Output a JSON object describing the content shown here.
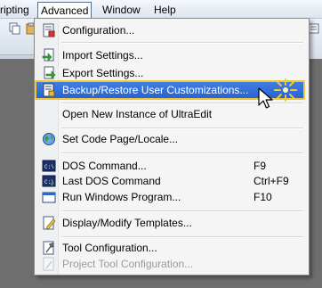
{
  "menubar": {
    "items": [
      {
        "label": "ripting"
      },
      {
        "label": "Advanced"
      },
      {
        "label": "Window"
      },
      {
        "label": "Help"
      }
    ]
  },
  "menu": {
    "items": [
      {
        "label": "Configuration...",
        "icon": "configuration-icon"
      },
      {
        "label": "Import Settings...",
        "icon": "import-settings-icon"
      },
      {
        "label": "Export Settings...",
        "icon": "export-settings-icon"
      },
      {
        "label": "Backup/Restore User Customizations...",
        "icon": "backup-restore-icon"
      },
      {
        "label": "Open New Instance of UltraEdit"
      },
      {
        "label": "Set Code Page/Locale...",
        "icon": "globe-icon"
      },
      {
        "label": "DOS Command...",
        "shortcut": "F9",
        "icon": "dos-command-icon"
      },
      {
        "label": "Last DOS Command",
        "shortcut": "Ctrl+F9",
        "icon": "last-dos-command-icon"
      },
      {
        "label": "Run Windows Program...",
        "shortcut": "F10",
        "icon": "run-program-icon"
      },
      {
        "label": "Display/Modify Templates...",
        "icon": "templates-icon"
      },
      {
        "label": "Tool Configuration...",
        "icon": "tool-configuration-icon"
      },
      {
        "label": "Project Tool Configuration...",
        "icon": "project-tool-icon"
      }
    ]
  },
  "colors": {
    "highlight": "#2f6fdc",
    "highlight_border": "#f0c53a",
    "disabled_text": "#9a9a9a"
  }
}
